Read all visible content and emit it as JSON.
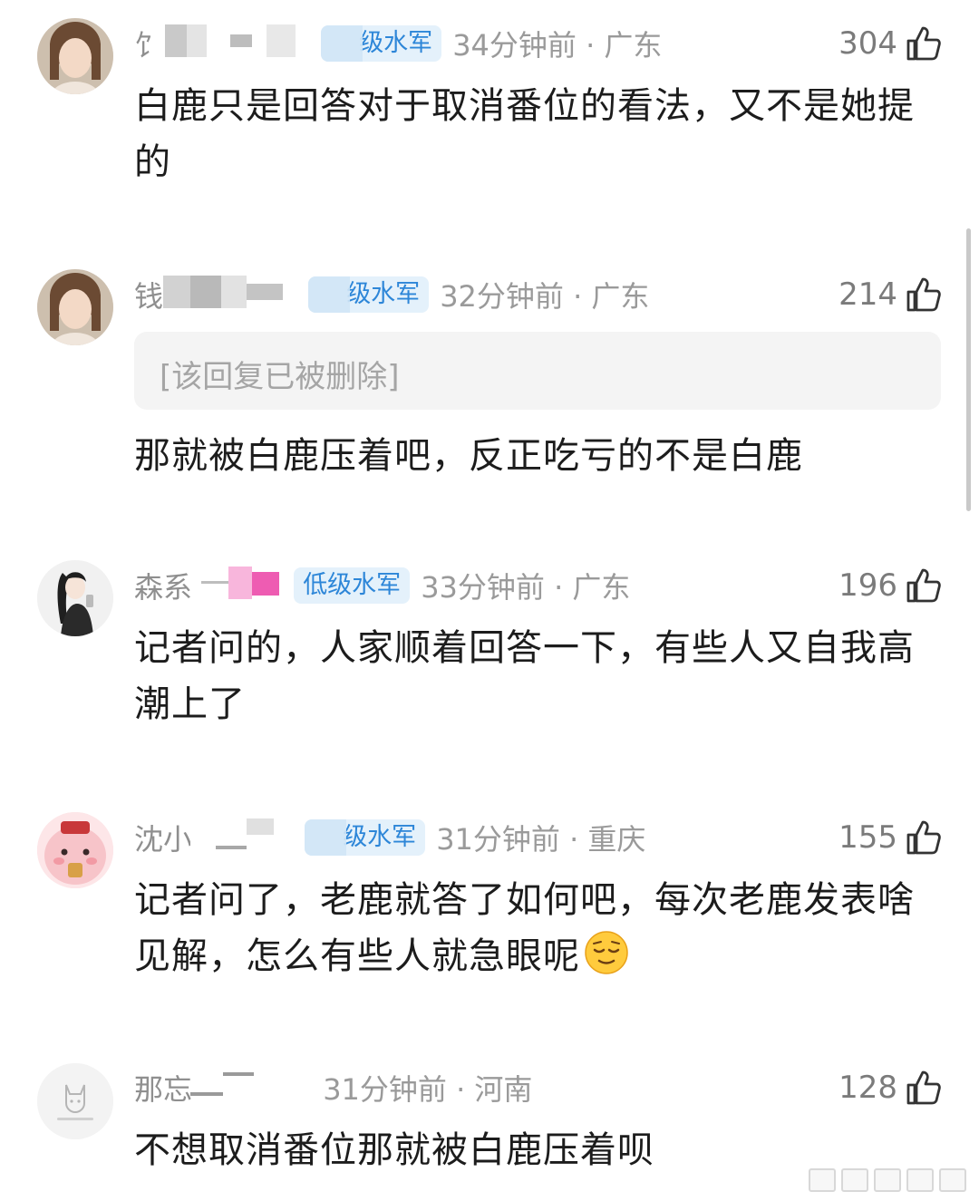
{
  "comments": [
    {
      "username": "饣",
      "badge": "级水军",
      "time_location": "34分钟前 · 广东",
      "likes": "304",
      "deleted_reply": "",
      "text": "白鹿只是回答对于取消番位的看法，又不是她提的",
      "avatar_icon": "user-avatar-icon"
    },
    {
      "username": "钱",
      "badge": "级水军",
      "time_location": "32分钟前 · 广东",
      "likes": "214",
      "deleted_reply": "[该回复已被删除]",
      "text": "那就被白鹿压着吧，反正吃亏的不是白鹿",
      "avatar_icon": "user-avatar-icon"
    },
    {
      "username": "森系",
      "badge": "低级水军",
      "time_location": "33分钟前 · 广东",
      "likes": "196",
      "deleted_reply": "",
      "text": "记者问的，人家顺着回答一下，有些人又自我高潮上了",
      "avatar_icon": "user-avatar-icon"
    },
    {
      "username": "沈小",
      "badge": "级水军",
      "time_location": "31分钟前 · 重庆",
      "likes": "155",
      "deleted_reply": "",
      "text": "记者问了，老鹿就答了如何吧，每次老鹿发表啥见解，怎么有些人就急眼呢",
      "avatar_icon": "user-avatar-icon",
      "emoji": "relieved-face-emoji"
    },
    {
      "username": "那忘",
      "badge": "",
      "time_location": "31分钟前 · 河南",
      "likes": "128",
      "deleted_reply": "",
      "text": "不想取消番位那就被白鹿压着呗",
      "avatar_icon": "deactivated-user-avatar-icon"
    }
  ],
  "colors": {
    "badge_text": "#2d86d8",
    "badge_bg": "#e4f1fb",
    "meta_gray": "#9a9a9a",
    "text": "#1c1c1c"
  }
}
